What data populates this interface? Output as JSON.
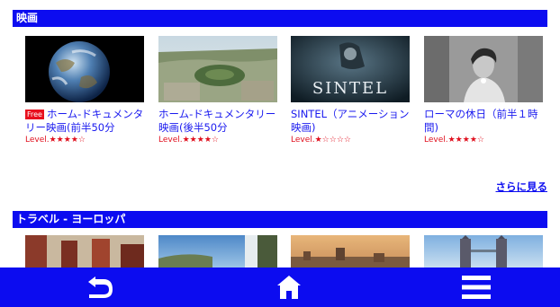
{
  "sections": {
    "movies": {
      "title": "映画",
      "items": [
        {
          "free_badge": "Free",
          "title": "ホーム-ドキュメンタリー映画(前半50分",
          "level": "Level.★★★★☆"
        },
        {
          "title": "ホーム-ドキュメンタリー映画(後半50分",
          "level": "Level.★★★★☆"
        },
        {
          "title": "SINTEL（アニメーション映画)",
          "level": "Level.★☆☆☆☆",
          "thumb_text": "SINTEL"
        },
        {
          "title": "ローマの休日（前半１時間)",
          "level": "Level.★★★★☆"
        }
      ],
      "more_label": "さらに見る"
    },
    "travel": {
      "title": "トラベル - ヨーロッパ"
    }
  },
  "bottom_nav": {
    "icons": [
      "back-icon",
      "home-icon",
      "menu-icon"
    ]
  },
  "colors": {
    "accent": "#0c0cf0",
    "link": "#1a1aef",
    "level_red": "#e0101e"
  }
}
